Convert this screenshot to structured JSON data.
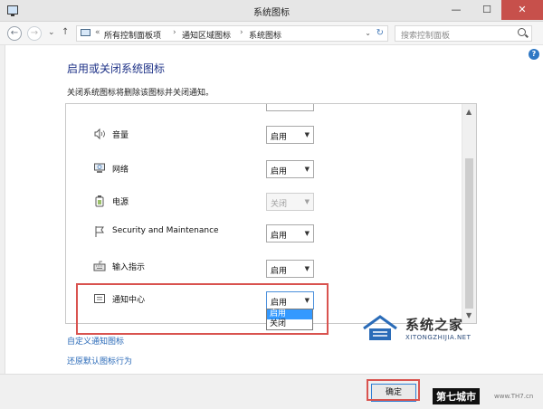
{
  "window": {
    "title": "系统图标",
    "minimize": "—",
    "maximize": "☐",
    "close": "✕"
  },
  "nav": {
    "back": "←",
    "forward": "→",
    "history": "⌄",
    "up": "↑"
  },
  "address": {
    "prefix": "«",
    "crumbs": [
      "所有控制面板项",
      "通知区域图标",
      "系统图标"
    ],
    "separator": "›",
    "dropdown": "⌄",
    "refresh": "↻"
  },
  "search": {
    "placeholder": "搜索控制面板"
  },
  "help": "?",
  "heading": "启用或关闭系统图标",
  "description": "关闭系统图标将删除该图标并关闭通知。",
  "rows": [
    {
      "icon": "speaker-icon",
      "label": "音量",
      "value": "启用",
      "disabled": false
    },
    {
      "icon": "network-icon",
      "label": "网络",
      "value": "启用",
      "disabled": false
    },
    {
      "icon": "power-icon",
      "label": "电源",
      "value": "关闭",
      "disabled": true
    },
    {
      "icon": "flag-icon",
      "label": "Security and Maintenance",
      "value": "启用",
      "disabled": false
    },
    {
      "icon": "keyboard-icon",
      "label": "输入指示",
      "value": "启用",
      "disabled": false
    },
    {
      "icon": "action-center-icon",
      "label": "通知中心",
      "value": "启用",
      "disabled": false
    }
  ],
  "dropdown": {
    "options": [
      "启用",
      "关闭"
    ],
    "selected": 0
  },
  "links": {
    "customize": "自定义通知图标",
    "restore": "还原默认图标行为"
  },
  "ok_button": "确定",
  "watermark": {
    "cn": "系统之家",
    "en": "XITONGZHIJIA.NET",
    "badge": "第七城市",
    "site": "www.TH7.cn"
  },
  "colors": {
    "heading": "#1e3287",
    "link": "#2a6ab8",
    "highlight": "#d9534f",
    "selection": "#3399ff"
  }
}
